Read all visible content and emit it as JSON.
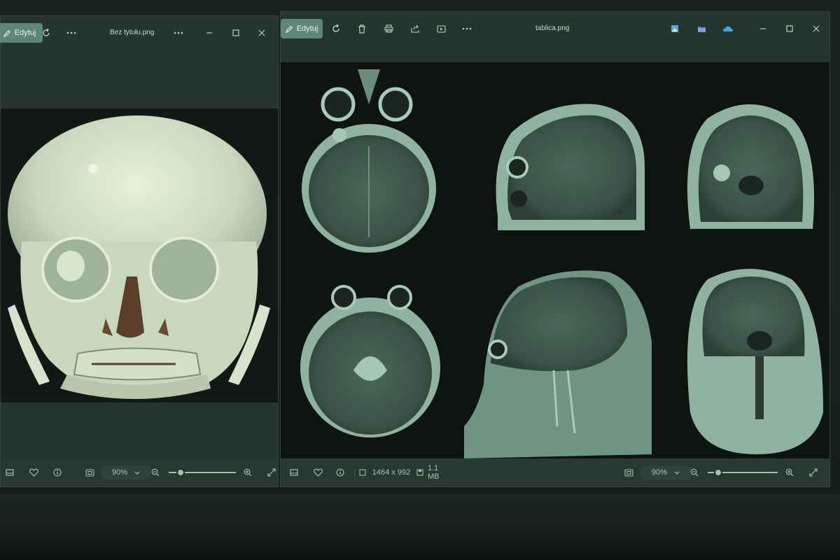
{
  "left_window": {
    "edit_label": "Edytuj",
    "title": "Bez tytułu.png",
    "zoom": "90%",
    "zoom_fraction": 0.18
  },
  "right_window": {
    "edit_label": "Edytuj",
    "title": "tablica.png",
    "dimensions": "1464 x 992",
    "filesize": "1.1 MB",
    "zoom": "90%",
    "zoom_fraction": 0.15
  },
  "icons": {
    "rotate": "rotate-icon",
    "delete": "trash-icon",
    "print": "print-icon",
    "share": "share-icon",
    "slideshow": "slideshow-icon",
    "more": "more-icon",
    "minimize": "minimize-icon",
    "maximize": "maximize-icon",
    "close": "close-icon"
  },
  "colors": {
    "accent": "#5f8777",
    "canvas": "#0e1412",
    "window": "#27352f"
  }
}
